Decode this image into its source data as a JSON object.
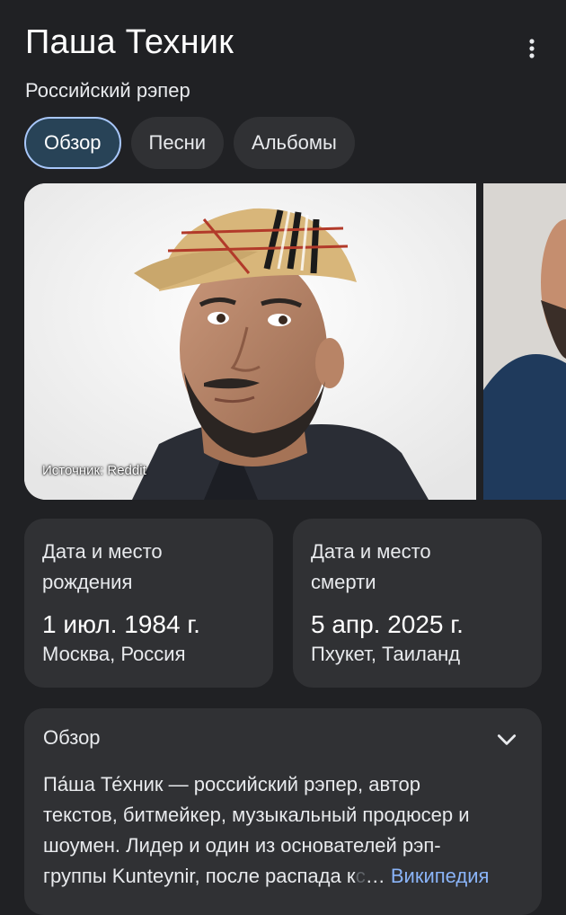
{
  "header": {
    "title": "Паша Техник",
    "subtitle": "Российский рэпер"
  },
  "tabs": [
    {
      "label": "Обзор",
      "active": true
    },
    {
      "label": "Песни",
      "active": false
    },
    {
      "label": "Альбомы",
      "active": false
    }
  ],
  "images": {
    "main_source": "Источник: Reddit"
  },
  "facts": [
    {
      "label_line1": "Дата и место",
      "label_line2": "рождения",
      "value": "1 июл. 1984 г.",
      "place": "Москва, Россия"
    },
    {
      "label_line1": "Дата и место",
      "label_line2": "смерти",
      "value": "5 апр. 2025 г.",
      "place": "Пхукет, Таиланд"
    }
  ],
  "overview": {
    "title": "Обзор",
    "lines": [
      "Па́ша Те́хник — российский рэпер, автор",
      "текстов, битмейкер, музыкальный продюсер и",
      "шоумен. Лидер и один из основателей рэп-",
      "группы Kunteynir, после распада к"
    ],
    "fade_tail": "с",
    "ellipsis": "…",
    "link": "Википедия"
  },
  "colors": {
    "background": "#202124",
    "card": "#303134",
    "active_tab_bg": "#284357",
    "active_tab_border": "#a8c7fa",
    "link": "#8ab4f8"
  },
  "icons": {
    "more": "more-vert-icon",
    "expand": "chevron-down-icon"
  }
}
